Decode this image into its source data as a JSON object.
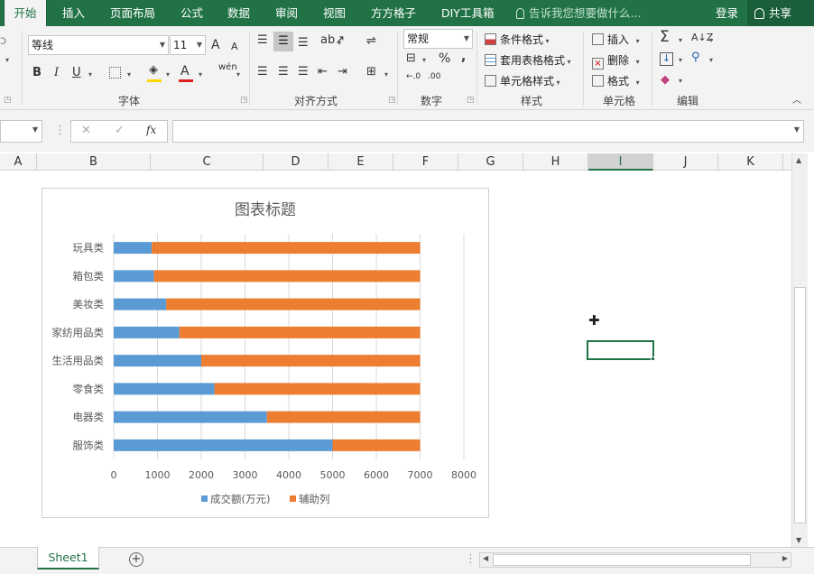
{
  "tabs": [
    "开始",
    "插入",
    "页面布局",
    "公式",
    "数据",
    "审阅",
    "视图",
    "方方格子",
    "DIY工具箱"
  ],
  "tell_me": "告诉我您想要做什么...",
  "login": "登录",
  "share": "共享",
  "font": {
    "name": "等线",
    "size": "11",
    "bold": "B",
    "italic": "I",
    "underline": "U",
    "grow": "A",
    "shrink": "A",
    "font_color_glyph": "A",
    "phonetic": "wén"
  },
  "number": {
    "format": "常规",
    "percent": "%",
    "comma": ",",
    "inc_dec": "←.0\n.00",
    "dec_dec": ".00\n→.0"
  },
  "styles": {
    "conditional": "条件格式",
    "table": "套用表格格式",
    "cell": "单元格样式"
  },
  "cells": {
    "insert": "插入",
    "delete": "删除",
    "format": "格式"
  },
  "groups": {
    "font": "字体",
    "align": "对齐方式",
    "number": "数字",
    "styles": "样式",
    "cells": "单元格",
    "edit": "编辑"
  },
  "formula_bar": {
    "name_box": "",
    "fx": "fx",
    "content": ""
  },
  "columns": [
    "A",
    "B",
    "C",
    "D",
    "E",
    "F",
    "G",
    "H",
    "I",
    "J",
    "K"
  ],
  "sheet_tab": "Sheet1",
  "colors": {
    "brand": "#217346",
    "series1": "#5b9bd5",
    "series2": "#ed7d31"
  },
  "chart_data": {
    "type": "bar",
    "stacked": true,
    "orientation": "horizontal",
    "title": "图表标题",
    "categories": [
      "玩具类",
      "箱包类",
      "美妆类",
      "家纺用品类",
      "生活用品类",
      "零食类",
      "电器类",
      "服饰类"
    ],
    "series": [
      {
        "name": "成交额(万元)",
        "values": [
          870,
          920,
          1200,
          1500,
          2000,
          2300,
          3500,
          5000
        ]
      },
      {
        "name": "辅助列",
        "values": [
          6130,
          6080,
          5800,
          5500,
          5000,
          4700,
          3500,
          2000
        ]
      }
    ],
    "xlim": [
      0,
      8000
    ],
    "xticks": [
      "0",
      "1000",
      "2000",
      "3000",
      "4000",
      "5000",
      "6000",
      "7000",
      "8000"
    ],
    "grid": true,
    "legend": "bottom"
  }
}
